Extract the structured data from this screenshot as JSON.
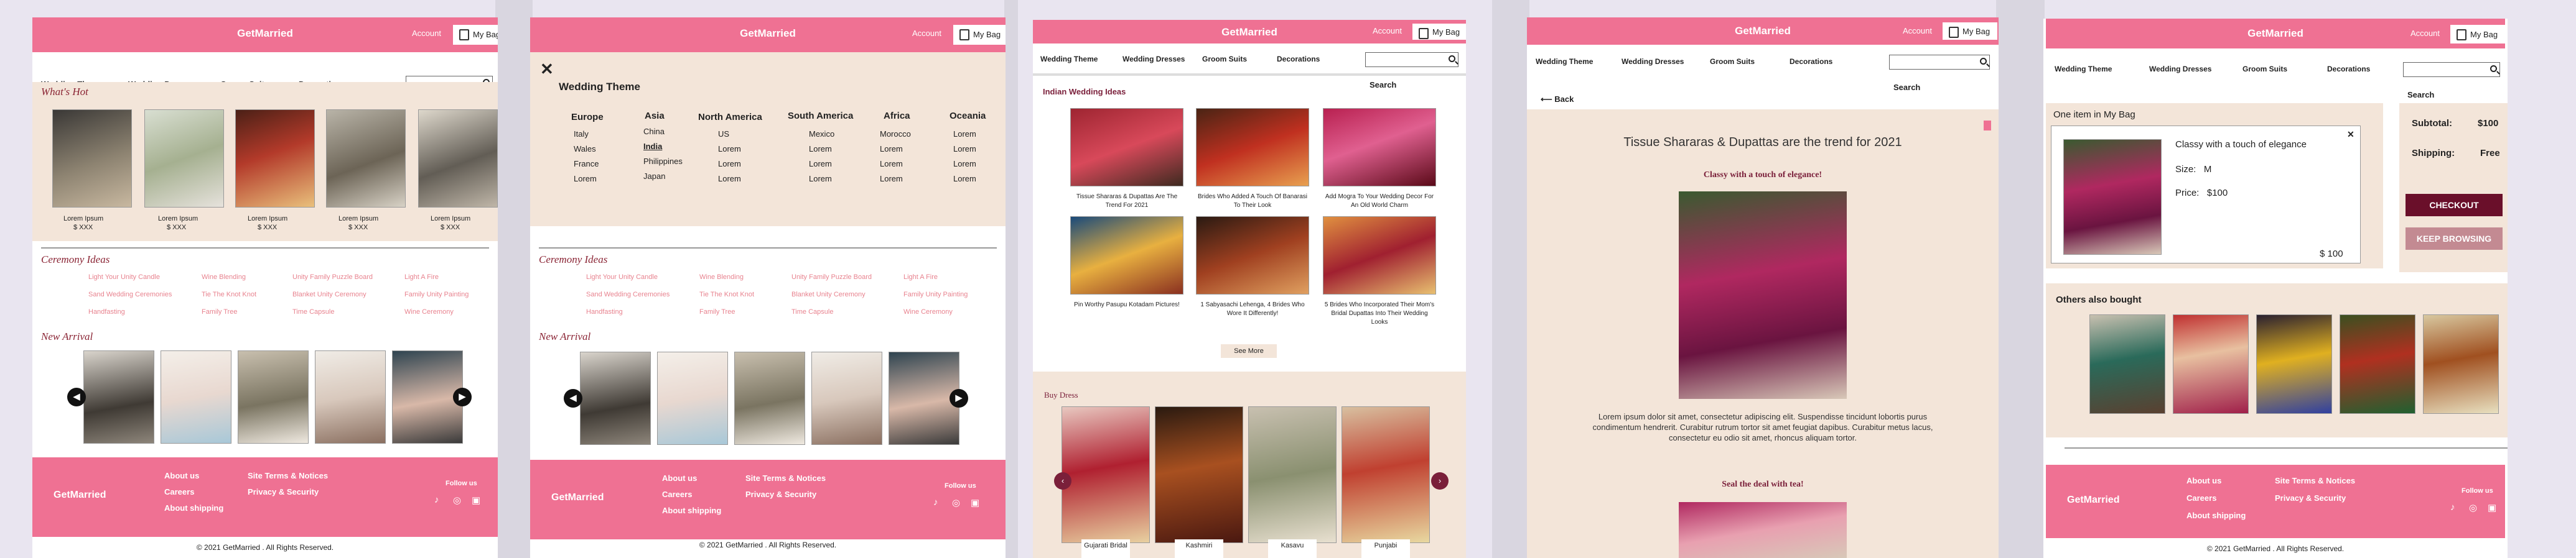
{
  "brand": "GetMarried",
  "account": "Account",
  "bag": "My Bag",
  "nav": [
    "Wedding Theme",
    "Wedding Dresses",
    "Groom Suits",
    "Decorations"
  ],
  "search_placeholder": "Search",
  "home": {
    "whats_hot": "What's Hot",
    "hot_items": [
      {
        "name": "Lorem Ipsum",
        "price": "$   XXX"
      },
      {
        "name": "Lorem Ipsum",
        "price": "$   XXX"
      },
      {
        "name": "Lorem Ipsum",
        "price": "$   XXX"
      },
      {
        "name": "Lorem Ipsum",
        "price": "$   XXX"
      },
      {
        "name": "Lorem Ipsum",
        "price": "$   XXX"
      }
    ],
    "ceremony_ideas": "Ceremony Ideas",
    "ideas": [
      "Light Your Unity Candle",
      "Sand Wedding Ceremonies",
      "Handfasting",
      "Wine Blending",
      "Tie The Knot Knot",
      "Family Tree",
      "Unity Family Puzzle Board",
      "Blanket Unity Ceremony",
      "Time Capsule",
      "Light A Fire",
      "Family Unity Painting",
      "Wine Ceremony"
    ],
    "new_arrival": "New Arrival"
  },
  "theme_menu": {
    "title": "Wedding Theme",
    "close": "✕",
    "columns": [
      {
        "name": "Europe",
        "items": [
          "Italy",
          "Wales",
          "France",
          "Lorem"
        ]
      },
      {
        "name": "Asia",
        "items": [
          "China",
          "India",
          "Philippines",
          "Japan"
        ]
      },
      {
        "name": "North America",
        "items": [
          "US",
          "Lorem",
          "Lorem",
          "Lorem"
        ]
      },
      {
        "name": "South America",
        "items": [
          "Mexico",
          "Lorem",
          "Lorem",
          "Lorem"
        ]
      },
      {
        "name": "Africa",
        "items": [
          "Morocco",
          "Lorem",
          "Lorem",
          "Lorem"
        ]
      },
      {
        "name": "Oceania",
        "items": [
          "Lorem",
          "Lorem",
          "Lorem",
          "Lorem"
        ]
      }
    ]
  },
  "india": {
    "title": "Indian Wedding Ideas",
    "articles": [
      "Tissue Shararas & Dupattas Are The Trend For 2021",
      "Brides Who Added A Touch Of Banarasi To Their Look",
      "Add Mogra To Your Wedding Decor For An Old World Charm",
      "Pin Worthy Pasupu Kotadam Pictures!",
      "1 Sabyasachi Lehenga, 4 Brides Who Wore It Differently!",
      "5 Brides Who Incorporated Their Mom's Bridal Dupattas Into Their Wedding Looks"
    ],
    "see_more": "See More",
    "buy_dress": "Buy Dress",
    "dresses": [
      "Gujarati Bridal",
      "Kashmiri",
      "Kasavu",
      "Punjabi"
    ]
  },
  "article": {
    "back": "Back",
    "title": "Tissue Shararas & Dupattas are the trend for 2021",
    "subtitle": "Classy with a touch of elegance!",
    "body": "Lorem ipsum dolor sit amet, consectetur adipiscing elit. Suspendisse tincidunt lobortis purus condimentum hendrerit. Curabitur rutrum tortor sit amet feugiat dapibus. Curabitur metus lacus, consectetur eu odio sit amet, rhoncus aliquam tortor.",
    "subtitle2": "Seal the deal with tea!"
  },
  "cart": {
    "heading": "One item in My Bag",
    "item_name": "Classy with a touch of elegance",
    "size_label": "Size:",
    "size": "M",
    "price_label": "Price:",
    "price": "$100",
    "line_total": "$ 100",
    "subtotal_label": "Subtotal:",
    "subtotal": "$100",
    "shipping_label": "Shipping:",
    "shipping": "Free",
    "checkout": "CHECKOUT",
    "keep": "KEEP BROWSING",
    "others": "Others also bought"
  },
  "footer": {
    "links": [
      "About us",
      "Careers",
      "About shipping",
      "Site Terms & Notices",
      "Privacy & Security"
    ],
    "follow": "Follow us",
    "copyright": "© 2021 GetMarried . All Rights Reserved."
  },
  "colors": {
    "pink": "#ef7193",
    "cream": "#f3e5d9",
    "maroon": "#7a1f3a"
  }
}
